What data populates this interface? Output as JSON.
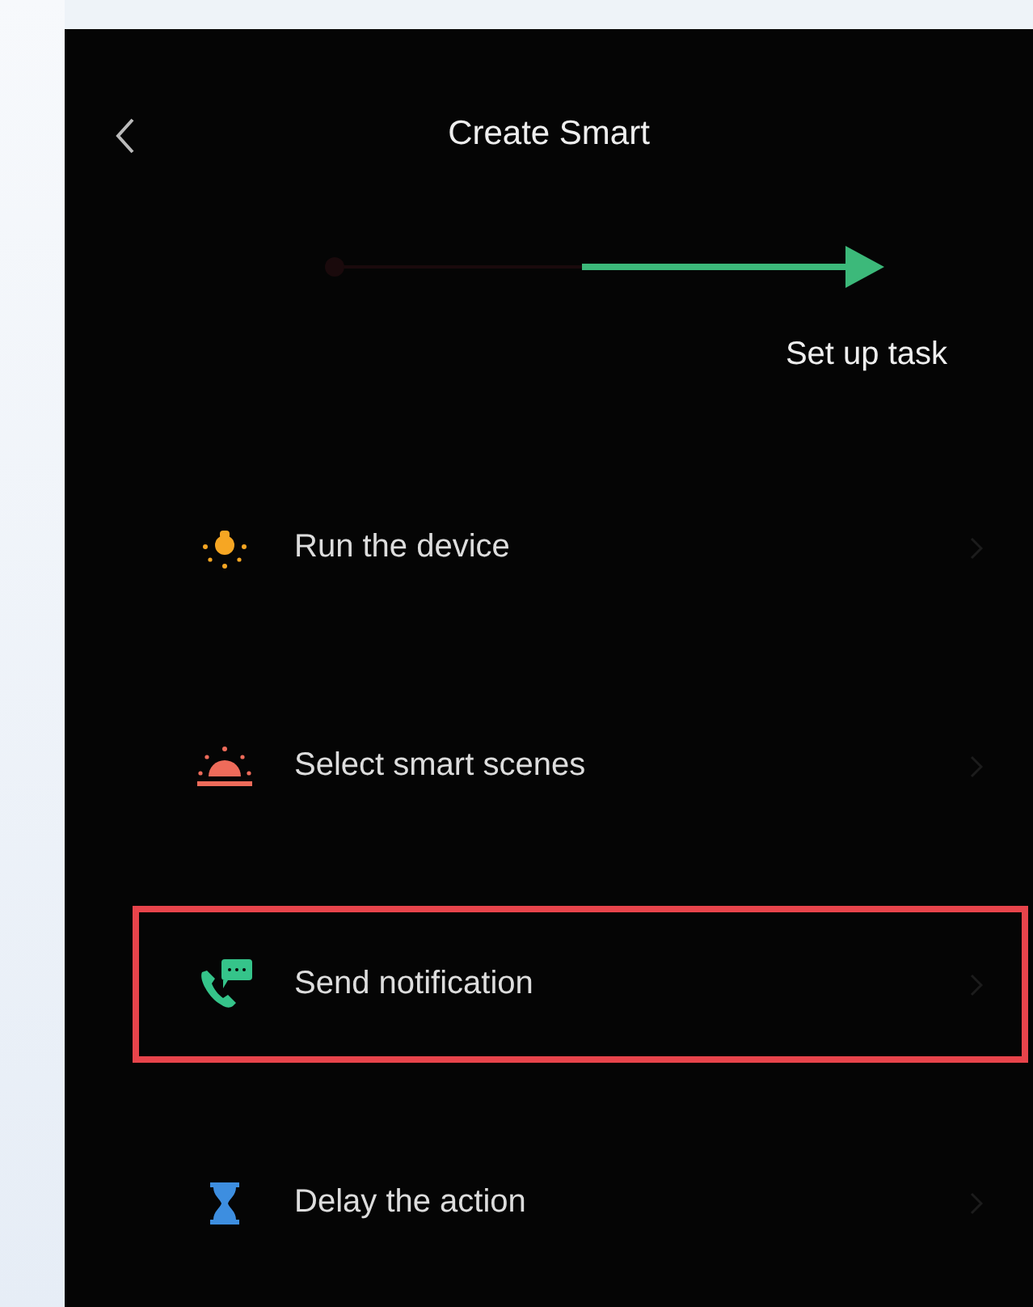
{
  "header": {
    "title": "Create Smart"
  },
  "stepper": {
    "label": "Set up task"
  },
  "actions": [
    {
      "kind": "bulb",
      "label": "Run the device",
      "highlighted": false
    },
    {
      "kind": "sunrise",
      "label": "Select smart scenes",
      "highlighted": false
    },
    {
      "kind": "notify",
      "label": "Send notification",
      "highlighted": true
    },
    {
      "kind": "hourglass",
      "label": "Delay the action",
      "highlighted": false
    }
  ]
}
